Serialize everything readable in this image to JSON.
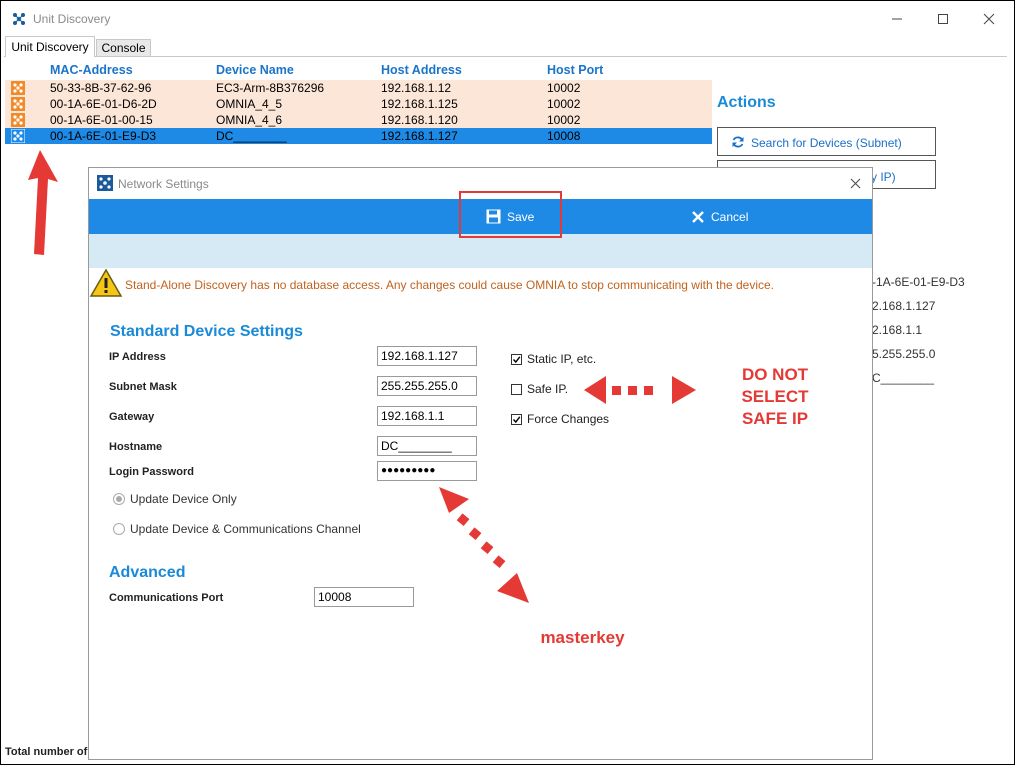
{
  "window": {
    "title": "Unit Discovery"
  },
  "tabs": [
    {
      "label": "Unit Discovery"
    },
    {
      "label": "Console"
    }
  ],
  "device_table": {
    "columns": [
      "MAC-Address",
      "Device Name",
      "Host Address",
      "Host Port"
    ],
    "rows": [
      {
        "mac": "50-33-8B-37-62-96",
        "name": "EC3-Arm-8B376296",
        "host": "192.168.1.12",
        "port": "10002"
      },
      {
        "mac": "00-1A-6E-01-D6-2D",
        "name": "OMNIA_4_5",
        "host": "192.168.1.125",
        "port": "10002"
      },
      {
        "mac": "00-1A-6E-01-00-15",
        "name": "OMNIA_4_6",
        "host": "192.168.1.120",
        "port": "10002"
      },
      {
        "mac": "00-1A-6E-01-E9-D3",
        "name": "DC________",
        "host": "192.168.1.127",
        "port": "10008"
      }
    ]
  },
  "actions": {
    "title": "Actions",
    "search_subnet": "Search for Devices (Subnet)",
    "search_ip_partial": "y IP)"
  },
  "side_info": [
    "-1A-6E-01-E9-D3",
    "2.168.1.127",
    "2.168.1.1",
    "5.255.255.0",
    "C________"
  ],
  "status_text": "Total number of",
  "dialog": {
    "title": "Network Settings",
    "save_label": "Save",
    "cancel_label": "Cancel",
    "warning": "Stand-Alone Discovery has no database access.  Any changes could cause OMNIA to stop communicating with the device.",
    "standard_title": "Standard Device Settings",
    "fields": {
      "ip_label": "IP Address",
      "ip_value": "192.168.1.127",
      "subnet_label": "Subnet Mask",
      "subnet_value": "255.255.255.0",
      "gateway_label": "Gateway",
      "gateway_value": "192.168.1.1",
      "hostname_label": "Hostname",
      "hostname_value": "DC________",
      "password_label": "Login Password",
      "password_value": "●●●●●●●●●"
    },
    "checkboxes": [
      {
        "label": "Static IP, etc.",
        "checked": true
      },
      {
        "label": "Safe IP.",
        "checked": false
      },
      {
        "label": "Force Changes",
        "checked": true
      }
    ],
    "radios": [
      {
        "label": "Update Device Only",
        "selected": true
      },
      {
        "label": "Update Device & Communications Channel",
        "selected": false
      }
    ],
    "advanced_title": "Advanced",
    "comm_port_label": "Communications Port",
    "comm_port_value": "10008"
  },
  "annotations": {
    "warning_line1": "DO NOT",
    "warning_line2": "SELECT",
    "warning_line3": "SAFE IP",
    "masterkey": "masterkey"
  },
  "colors": {
    "accent": "#1e8ae6",
    "row_tint": "#fbe6d8",
    "annotation_red": "#e53935",
    "warning_text": "#c2621d"
  }
}
